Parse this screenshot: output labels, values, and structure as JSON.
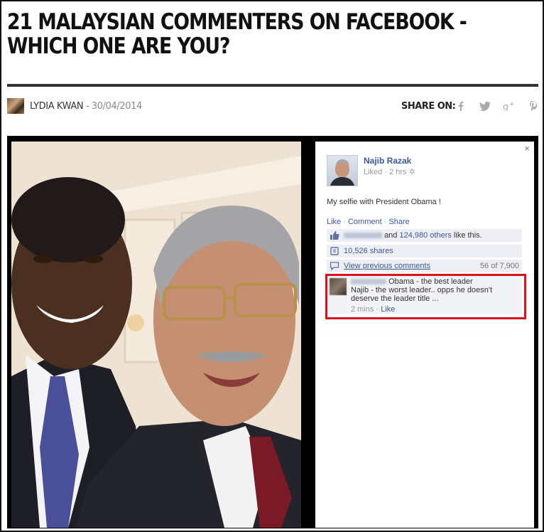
{
  "article": {
    "title": "21 Malaysian Commenters on Facebook - Which One Are You?",
    "author": "Lydia Kwan",
    "date": "30/04/2014",
    "share_label": "SHARE ON:",
    "share_icons": [
      "facebook-icon",
      "twitter-icon",
      "google-plus-icon",
      "pinterest-icon"
    ]
  },
  "facebook_post": {
    "close_label": "×",
    "poster_name": "Najib Razak",
    "post_meta": "Liked · 2 hrs",
    "post_text": "My selfie with President Obama !",
    "actions": {
      "like": "Like",
      "comment": "Comment",
      "share": "Share"
    },
    "likes_text": "and 124,980 others like this.",
    "likes_suffix": " like this.",
    "likes_others": "124,980 others",
    "likes_and": "and ",
    "shares_text": "10,526 shares",
    "view_previous": "View previous comments",
    "comment_count": "56 of 7,900",
    "comment": {
      "line1": "Obama - the best leader",
      "line2": "Najib - the worst leader.. opps he doesn't deserve the leader title ...",
      "time": "2 mins",
      "like": "Like"
    }
  },
  "colors": {
    "facebook_blue": "#3b5998",
    "highlight_red": "#d8121e"
  }
}
